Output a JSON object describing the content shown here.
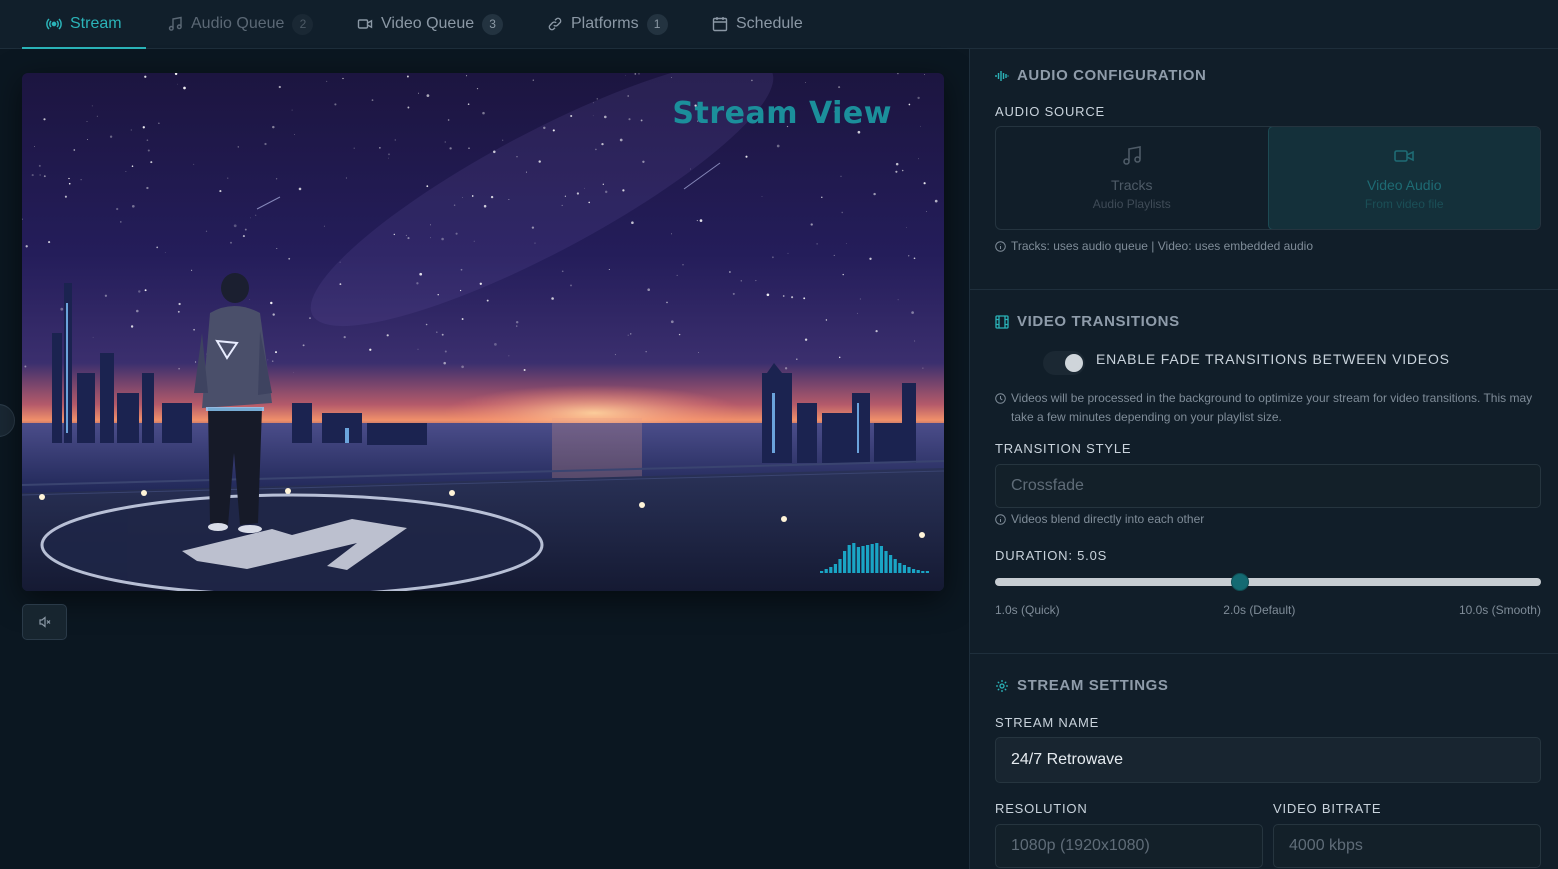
{
  "tabs": [
    {
      "label": "Stream",
      "badge": null,
      "icon": "broadcast-icon",
      "state": "active"
    },
    {
      "label": "Audio Queue",
      "badge": "2",
      "icon": "music-note-icon",
      "state": "dim"
    },
    {
      "label": "Video Queue",
      "badge": "3",
      "icon": "video-camera-icon",
      "state": "normal"
    },
    {
      "label": "Platforms",
      "badge": "1",
      "icon": "link-icon",
      "state": "normal"
    },
    {
      "label": "Schedule",
      "badge": null,
      "icon": "calendar-icon",
      "state": "normal"
    }
  ],
  "preview": {
    "overlay_title": "Stream View",
    "mute_icon": "speaker-muted-icon"
  },
  "audio_config": {
    "heading": "AUDIO CONFIGURATION",
    "source_label": "AUDIO SOURCE",
    "options": [
      {
        "title": "Tracks",
        "subtitle": "Audio Playlists",
        "icon": "music-note-icon",
        "selected": false
      },
      {
        "title": "Video Audio",
        "subtitle": "From video file",
        "icon": "video-camera-icon",
        "selected": true
      }
    ],
    "hint": "Tracks: uses audio queue | Video: uses embedded audio"
  },
  "video_transitions": {
    "heading": "VIDEO TRANSITIONS",
    "toggle_label": "ENABLE FADE TRANSITIONS BETWEEN VIDEOS",
    "toggle_on": true,
    "processing_hint": "Videos will be processed in the background to optimize your stream for video transitions. This may take a few minutes depending on your playlist size.",
    "style_label": "TRANSITION STYLE",
    "style_value": "Crossfade",
    "style_hint": "Videos blend directly into each other",
    "duration_label": "DURATION: 5.0S",
    "duration_fraction": 0.448,
    "ticks": [
      "1.0s (Quick)",
      "2.0s (Default)",
      "10.0s (Smooth)"
    ]
  },
  "stream_settings": {
    "heading": "STREAM SETTINGS",
    "name_label": "STREAM NAME",
    "name_value": "24/7 Retrowave",
    "resolution_label": "RESOLUTION",
    "resolution_value": "1080p (1920x1080)",
    "bitrate_label": "VIDEO BITRATE",
    "bitrate_value": "4000 kbps"
  },
  "colors": {
    "accent": "#2bb3b8",
    "background": "#0b1721",
    "panel": "#111e29"
  }
}
